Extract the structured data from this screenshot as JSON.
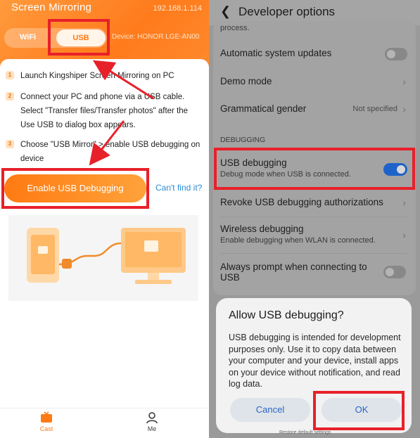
{
  "left": {
    "app_title": "Screen Mirroring",
    "ip": "192.168.1.114",
    "tabs": {
      "wifi": "WiFi",
      "usb": "USB"
    },
    "device": "Device: HONOR LGE-AN00",
    "steps": [
      {
        "num": "1",
        "text": "Launch Kingshiper Screen Mirroring on PC"
      },
      {
        "num": "2",
        "text": "Connect your PC and phone via a USB cable. Select \"Transfer files/Transfer photos\" after the Use USB to dialog box appears."
      },
      {
        "num": "3",
        "text": "Choose \"USB Mirror\" > enable USB debugging on device"
      }
    ],
    "enable_button": "Enable USB Debugging",
    "cant_find": "Can't find it?",
    "tabbar": {
      "cast": "Cast",
      "me": "Me"
    },
    "colors": {
      "accent": "#ff7a14",
      "highlight": "#e8202a",
      "link": "#2a8bd6"
    }
  },
  "right": {
    "title": "Developer options",
    "partial_text": "process.",
    "rows": {
      "auto_updates": "Automatic system updates",
      "demo_mode": "Demo mode",
      "gender": "Grammatical gender",
      "gender_value": "Not specified",
      "section": "DEBUGGING",
      "usb_debugging": "USB debugging",
      "usb_debugging_sub": "Debug mode when USB is connected.",
      "revoke": "Revoke USB debugging authorizations",
      "wireless": "Wireless debugging",
      "wireless_sub": "Enable debugging when WLAN is connected.",
      "always_prompt": "Always prompt when connecting to USB"
    },
    "toggles": {
      "auto_updates": false,
      "usb_debugging": true,
      "always_prompt": false
    },
    "dialog": {
      "title": "Allow USB debugging?",
      "body": "USB debugging is intended for development purposes only. Use it to copy data between your computer and your device, install apps on your device without notification, and read log data.",
      "cancel": "Cancel",
      "ok": "OK"
    },
    "footer_peek": "Restore default settings"
  }
}
